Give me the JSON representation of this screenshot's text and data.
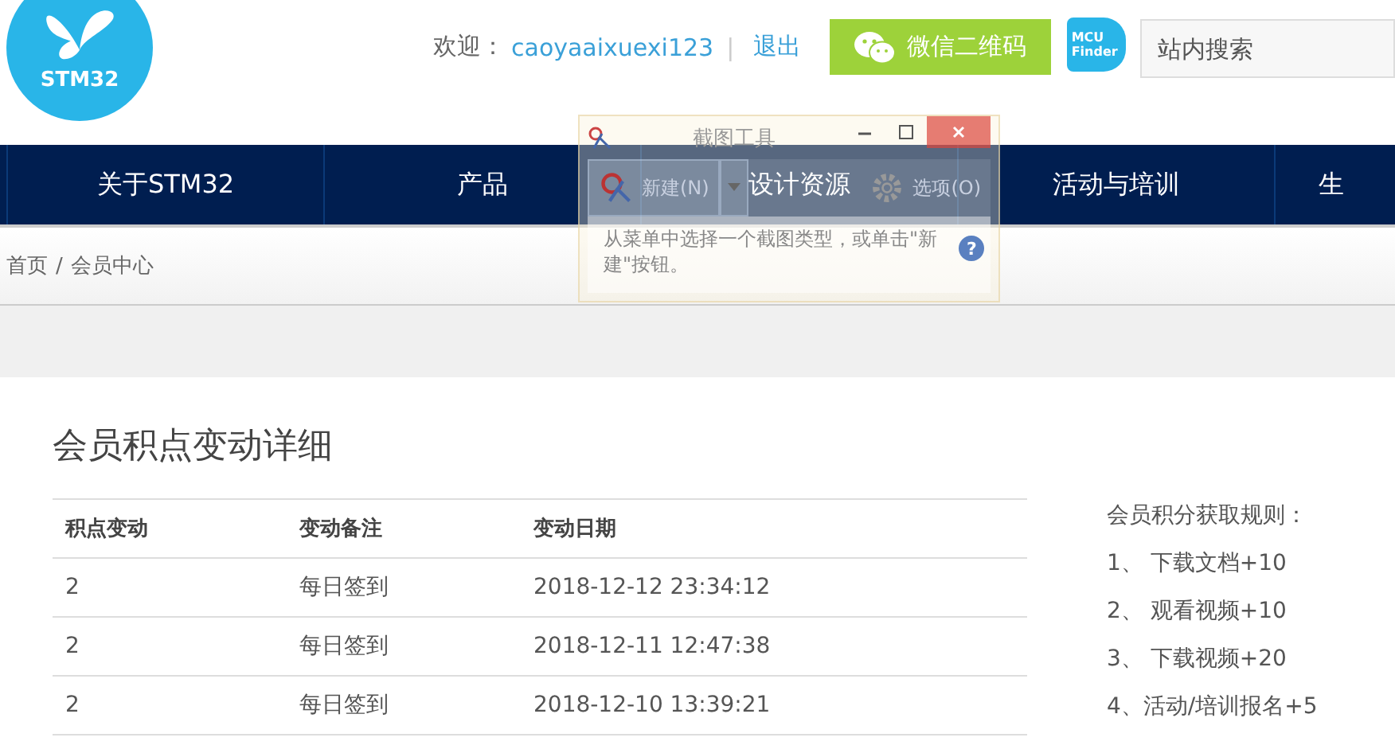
{
  "header": {
    "logo_text": "STM32",
    "welcome_label": "欢迎：",
    "username": "caoyaaixuexi123",
    "separator": "|",
    "logout": "退出",
    "wechat_button": "微信二维码",
    "mcu_finder": [
      "MCU",
      "Finder"
    ],
    "search": {
      "placeholder": "站内搜索"
    }
  },
  "nav": {
    "items": [
      {
        "label": "关于STM32"
      },
      {
        "label": "产品"
      },
      {
        "label": "设计资源"
      },
      {
        "label": "活动与培训"
      },
      {
        "label": "生"
      }
    ]
  },
  "breadcrumb": {
    "items": [
      "首页",
      "会员中心"
    ],
    "separator": "/"
  },
  "page_title": "会员积点变动详细",
  "table": {
    "columns": [
      "积点变动",
      "变动备注",
      "变动日期"
    ],
    "rows": [
      [
        "2",
        "每日签到",
        "2018-12-12 23:34:12"
      ],
      [
        "2",
        "每日签到",
        "2018-12-11 12:47:38"
      ],
      [
        "2",
        "每日签到",
        "2018-12-10 13:39:21"
      ]
    ]
  },
  "rules": {
    "title": "会员积分获取规则：",
    "items": [
      "1、 下载文档+10",
      "2、 观看视频+10",
      "3、 下载视频+20",
      "4、活动/培训报名+5"
    ]
  },
  "snipping_tool": {
    "title": "截图工具",
    "buttons": [
      {
        "kind": "new",
        "label": "新建(N)"
      },
      {
        "kind": "dropdown"
      },
      {
        "kind": "options",
        "label": "选项(O)"
      }
    ],
    "hint": "从菜单中选择一个截图类型，或单击\"新建\"按钮。",
    "help": "?"
  }
}
